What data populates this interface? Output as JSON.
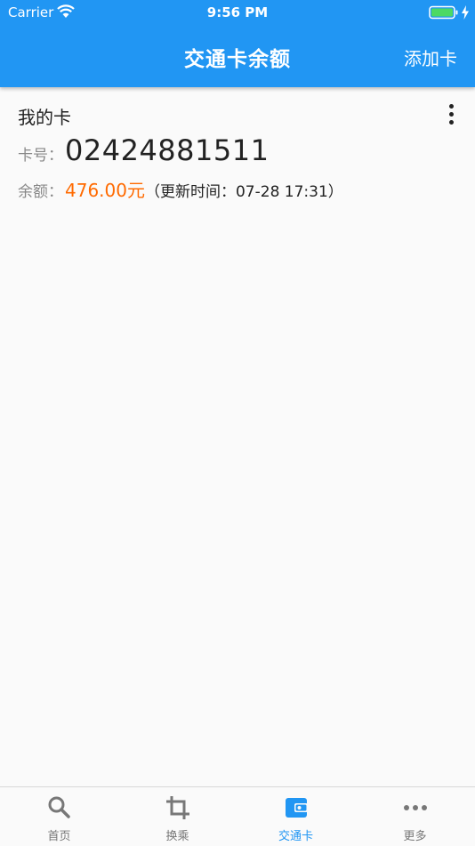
{
  "status_bar": {
    "carrier": "Carrier",
    "time": "9:56 PM"
  },
  "header": {
    "title": "交通卡余额",
    "add_card_label": "添加卡"
  },
  "card": {
    "name": "我的卡",
    "number_label": "卡号：",
    "number": "02424881511",
    "balance_label": "余额：",
    "balance": "476.00元",
    "update_text": "（更新时间：07-28 17:31）"
  },
  "tabs": [
    {
      "label": "首页",
      "icon": "search-icon",
      "active": false
    },
    {
      "label": "换乘",
      "icon": "crop-icon",
      "active": false
    },
    {
      "label": "交通卡",
      "icon": "wallet-icon",
      "active": true
    },
    {
      "label": "更多",
      "icon": "more-icon",
      "active": false
    }
  ],
  "colors": {
    "primary": "#2196f3",
    "balance": "#ff6a00",
    "tab_inactive": "#777777",
    "battery": "#4cd964"
  }
}
